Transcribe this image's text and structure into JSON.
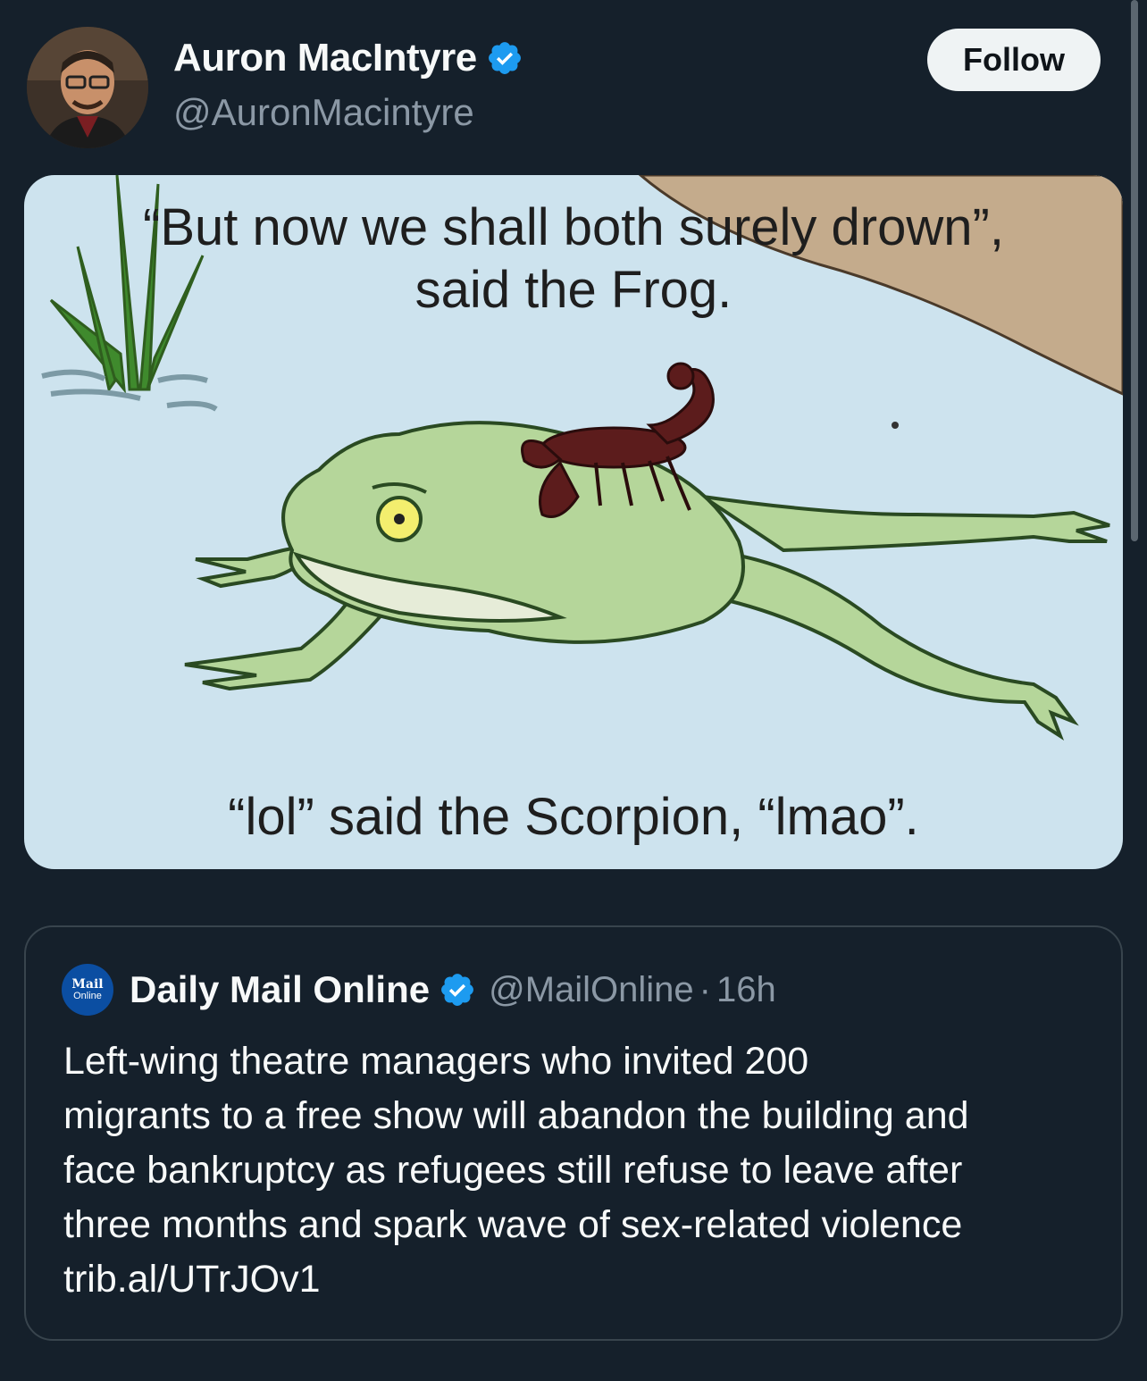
{
  "post": {
    "author_name": "Auron MacIntyre",
    "author_handle": "@AuronMacintyre",
    "follow_label": "Follow",
    "verified_color": "#1d9bf0",
    "media": {
      "caption_top_line1": "“But now we shall both surely drown”,",
      "caption_top_line2": "said the Frog.",
      "caption_bottom": "“lol” said the Scorpion, “lmao”."
    }
  },
  "quoted": {
    "avatar_label_top": "Mail",
    "avatar_label_bottom": "Online",
    "name": "Daily Mail Online",
    "handle": "@MailOnline",
    "separator": "·",
    "time": "16h",
    "text_lines": [
      "Left-wing theatre managers who invited 200",
      "migrants to a free show will abandon the building and",
      "face bankruptcy as refugees still refuse to leave after",
      "three months and spark wave of sex-related violence",
      "trib.al/UTrJOv1"
    ]
  },
  "colors": {
    "background": "#15202b",
    "text_primary": "#f7f9f9",
    "text_secondary": "#8b98a5",
    "border": "#38444d",
    "meme_water": "#cde3ee",
    "frog_green": "#b5d69a",
    "scorpion": "#5c1c1c"
  }
}
